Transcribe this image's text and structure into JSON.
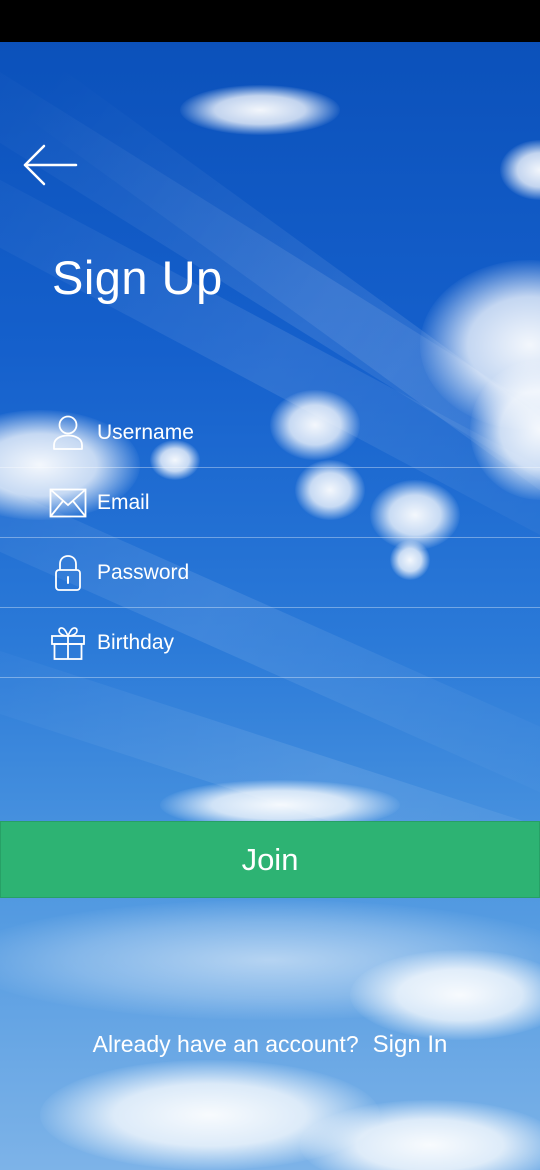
{
  "header": {
    "back_icon": "arrow-left-icon",
    "title": "Sign Up"
  },
  "form": {
    "fields": [
      {
        "icon": "user-icon",
        "placeholder": "Username",
        "value": ""
      },
      {
        "icon": "envelope-icon",
        "placeholder": "Email",
        "value": ""
      },
      {
        "icon": "lock-icon",
        "placeholder": "Password",
        "value": ""
      },
      {
        "icon": "gift-icon",
        "placeholder": "Birthday",
        "value": ""
      }
    ]
  },
  "actions": {
    "join_label": "Join"
  },
  "footer": {
    "prompt": "Already have an account?",
    "signin_label": "Sign In"
  },
  "colors": {
    "sky_top": "#0a4fb8",
    "sky_bottom": "#7db3e8",
    "join_button": "#2db373",
    "text": "#ffffff"
  }
}
